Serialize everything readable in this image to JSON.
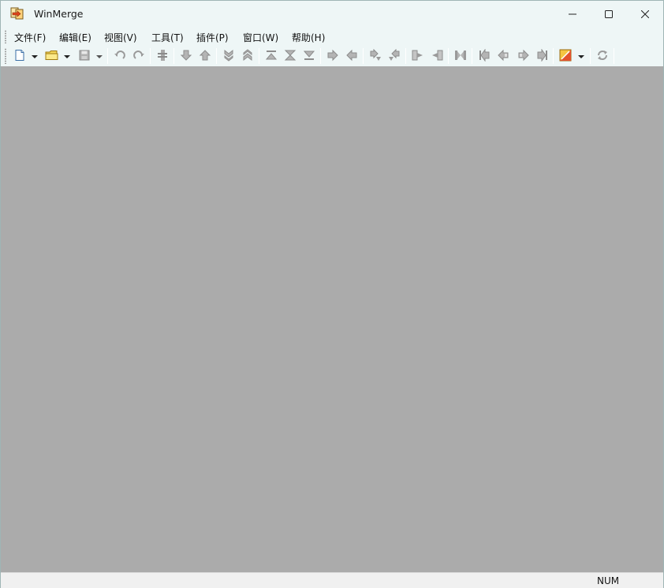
{
  "window": {
    "title": "WinMerge"
  },
  "titlebar": {
    "icon": "winmerge-logo-icon",
    "minimize_icon": "minimize-icon",
    "maximize_icon": "maximize-icon",
    "close_icon": "close-icon"
  },
  "menubar": {
    "items": [
      {
        "label": "文件(F)"
      },
      {
        "label": "编辑(E)"
      },
      {
        "label": "视图(V)"
      },
      {
        "label": "工具(T)"
      },
      {
        "label": "插件(P)"
      },
      {
        "label": "窗口(W)"
      },
      {
        "label": "帮助(H)"
      }
    ]
  },
  "toolbar": {
    "buttons": [
      {
        "icon": "new-document-icon",
        "has_dropdown": true
      },
      {
        "icon": "open-folder-icon",
        "has_dropdown": true
      },
      {
        "icon": "save-icon",
        "has_dropdown": true
      },
      {
        "icon": "undo-icon"
      },
      {
        "icon": "redo-icon"
      },
      {
        "icon": "toggle-compare-icon"
      },
      {
        "icon": "next-difference-icon"
      },
      {
        "icon": "previous-difference-icon"
      },
      {
        "icon": "next-conflict-icon"
      },
      {
        "icon": "previous-conflict-icon"
      },
      {
        "icon": "first-difference-icon"
      },
      {
        "icon": "current-difference-icon"
      },
      {
        "icon": "last-difference-icon"
      },
      {
        "icon": "copy-right-icon"
      },
      {
        "icon": "copy-left-icon"
      },
      {
        "icon": "copy-right-advance-icon"
      },
      {
        "icon": "copy-left-advance-icon"
      },
      {
        "icon": "copy-all-right-icon"
      },
      {
        "icon": "copy-all-left-icon"
      },
      {
        "icon": "merge-all-icon"
      },
      {
        "icon": "first-file-icon"
      },
      {
        "icon": "previous-file-icon"
      },
      {
        "icon": "next-file-icon"
      },
      {
        "icon": "last-file-icon"
      },
      {
        "icon": "options-icon",
        "has_dropdown": true
      },
      {
        "icon": "refresh-icon"
      }
    ]
  },
  "statusbar": {
    "num_lock": "NUM"
  },
  "colors": {
    "titlebar_bg": "#eef6f6",
    "client_bg": "#ababab",
    "statusbar_bg": "#f0f0f0"
  }
}
